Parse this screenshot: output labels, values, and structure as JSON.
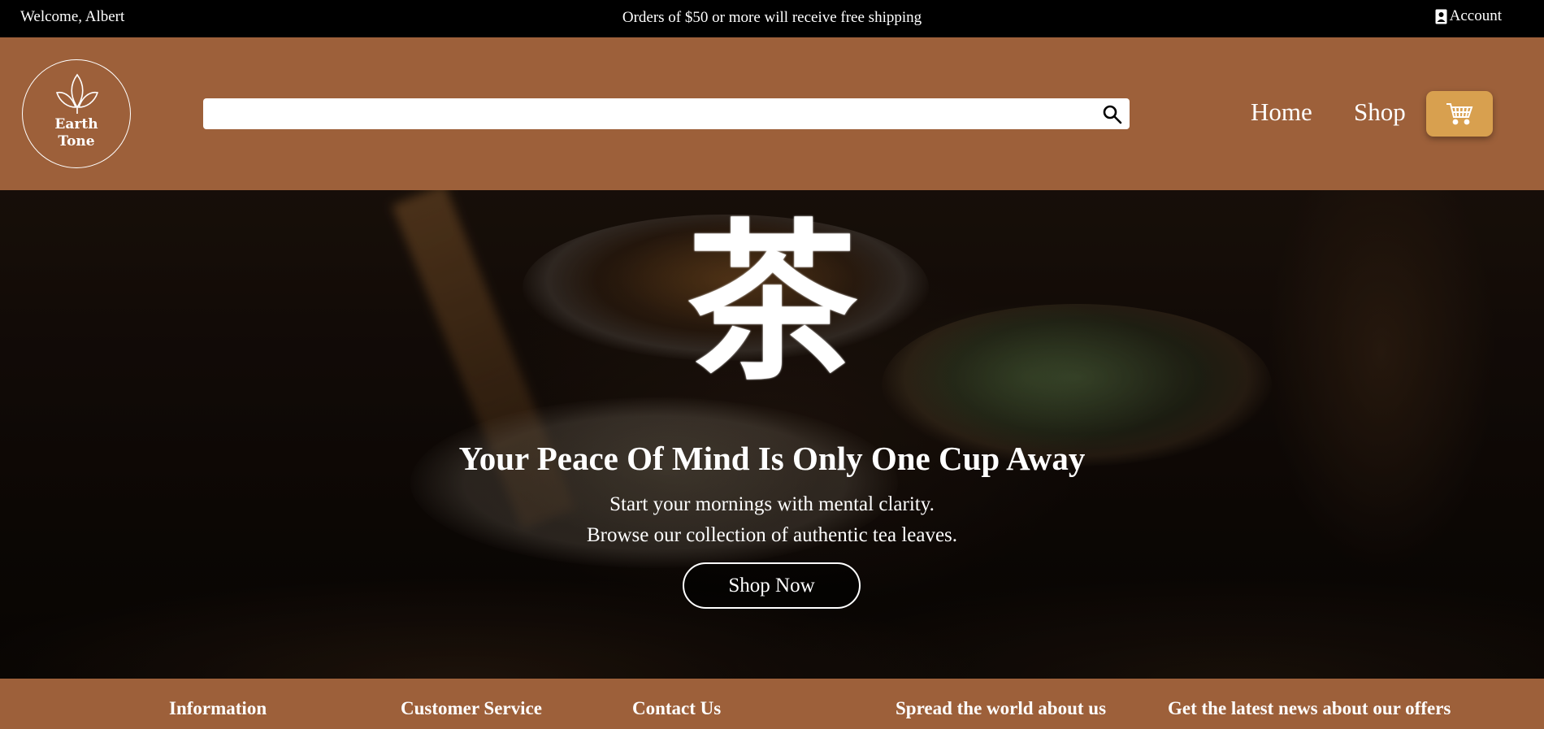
{
  "topbar": {
    "welcome": "Welcome, Albert",
    "promo": "Orders of $50 or more will receive free shipping",
    "account_label": "Account",
    "account_icon": "account-icon"
  },
  "header": {
    "logo_line1": "Earth",
    "logo_line2": "Tone",
    "logo_icon": "leaf-icon",
    "search": {
      "value": "",
      "placeholder": "",
      "icon": "search-icon"
    },
    "nav": {
      "home": "Home",
      "shop": "Shop"
    },
    "cart_icon": "cart-icon"
  },
  "hero": {
    "glyph": "茶",
    "title": "Your Peace Of Mind Is Only One Cup Away",
    "subtitle_line1": "Start your mornings with mental clarity.",
    "subtitle_line2": "Browse our collection of authentic tea leaves.",
    "cta": "Shop Now"
  },
  "footer": {
    "headings": [
      "Information",
      "Customer Service",
      "Contact Us",
      "Spread the world about us",
      "Get the latest news about our offers"
    ]
  },
  "colors": {
    "header_bg": "#9d603a",
    "topbar_bg": "#000000",
    "cart_button_bg": "#d8a04f",
    "text": "#ffffff"
  }
}
